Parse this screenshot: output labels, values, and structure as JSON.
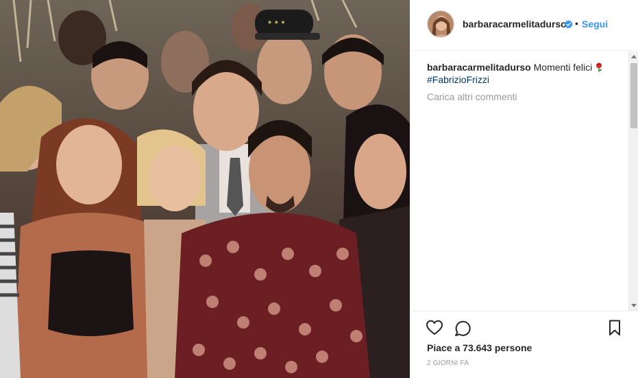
{
  "post": {
    "image_alt": "",
    "author": {
      "username": "barbaracarmelitadurso",
      "verified": true,
      "follow_label": "Segui",
      "separator": "•"
    },
    "caption": {
      "username": "barbaracarmelitadurso",
      "text": "Momenti felici",
      "emoji_icon": "rose-icon",
      "hashtag": "#FabrizioFrizzi"
    },
    "load_more_label": "Carica altri commenti",
    "likes_text": "Piace a 73.643 persone",
    "timestamp": "2 giorni fa"
  },
  "colors": {
    "link_blue": "#3897f0",
    "hashtag_navy": "#003569",
    "muted_gray": "#999999",
    "text_dark": "#262626"
  }
}
